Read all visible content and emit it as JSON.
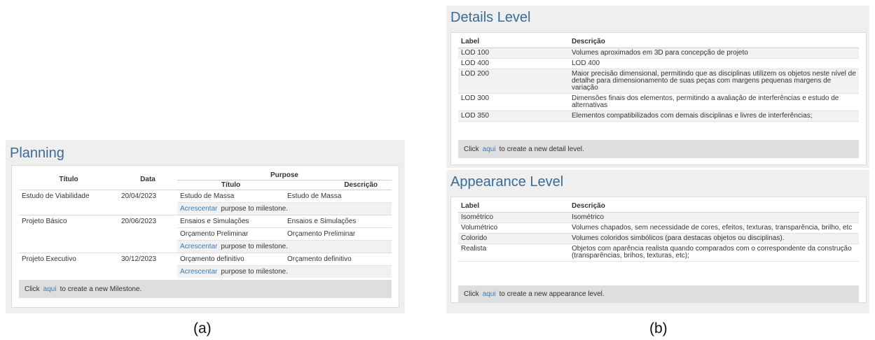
{
  "planning": {
    "title": "Planning",
    "headers": {
      "titulo": "Título",
      "data": "Data",
      "purpose": "Purpose",
      "p_titulo": "Título",
      "p_descricao": "Descrição"
    },
    "milestones": [
      {
        "titulo": "Estudo de Viabilidade",
        "data": "20/04/2023",
        "purposes": [
          {
            "titulo": "Estudo de Massa",
            "descricao": "Estudo de Massa"
          }
        ]
      },
      {
        "titulo": "Projeto Básico",
        "data": "20/06/2023",
        "purposes": [
          {
            "titulo": "Ensaios e Simulações",
            "descricao": "Ensaios e Simulações"
          },
          {
            "titulo": "Orçamento Preliminar",
            "descricao": "Orçamento Preliminar"
          }
        ]
      },
      {
        "titulo": "Projeto Executivo",
        "data": "30/12/2023",
        "purposes": [
          {
            "titulo": "Orçamento definitivo",
            "descricao": "Orçamento definitivo"
          }
        ]
      }
    ],
    "add_link": "Acrescentar",
    "add_text": "purpose to milestone.",
    "footer": {
      "click": "Click",
      "link": "aqui",
      "text": "to create a new Milestone."
    },
    "caption": "(a)"
  },
  "details": {
    "title": "Details Level",
    "headers": {
      "label": "Label",
      "descricao": "Descrição"
    },
    "rows": [
      {
        "label": "LOD 100",
        "descricao": "Volumes aproximados em 3D para concepção de projeto"
      },
      {
        "label": "LOD 400",
        "descricao": "LOD 400"
      },
      {
        "label": "LOD 200",
        "descricao": "Maior precisão dimensional, permitindo que as disciplinas utilizem os objetos neste nível de detalhe para dimensionamento de suas peças com margens pequenas margens de variação"
      },
      {
        "label": "LOD 300",
        "descricao": "Dimensões finais dos elementos, permitindo a avaliação de interferências e estudo de alternativas"
      },
      {
        "label": "LOD 350",
        "descricao": "Elementos compatibilizados com demais disciplinas e livres de interferências;"
      }
    ],
    "footer": {
      "click": "Click",
      "link": "aqui",
      "text": "to create a new detail level."
    }
  },
  "appearance": {
    "title": "Appearance Level",
    "headers": {
      "label": "Label",
      "descricao": "Descrição"
    },
    "rows": [
      {
        "label": "Isométrico",
        "descricao": "Isométrico"
      },
      {
        "label": "Volumétrico",
        "descricao": "Volumes chapados, sem necessidade de cores, efeitos, texturas, transparência, brilho, etc"
      },
      {
        "label": "Colorido",
        "descricao": "Volumes coloridos simbólicos (para destacas objetos ou disciplinas)."
      },
      {
        "label": "Realista",
        "descricao": "Objetos com aparência realista quando comparados com o correspondente da construção (transparências, brihos, texturas, etc);"
      }
    ],
    "footer": {
      "click": "Click",
      "link": "aqui",
      "text": "to create a new appearance level."
    },
    "caption": "(b)"
  },
  "colors": {
    "heading": "#3a6a96",
    "link": "#3a7ab9",
    "panel": "#efefef",
    "footer": "#dedede"
  }
}
